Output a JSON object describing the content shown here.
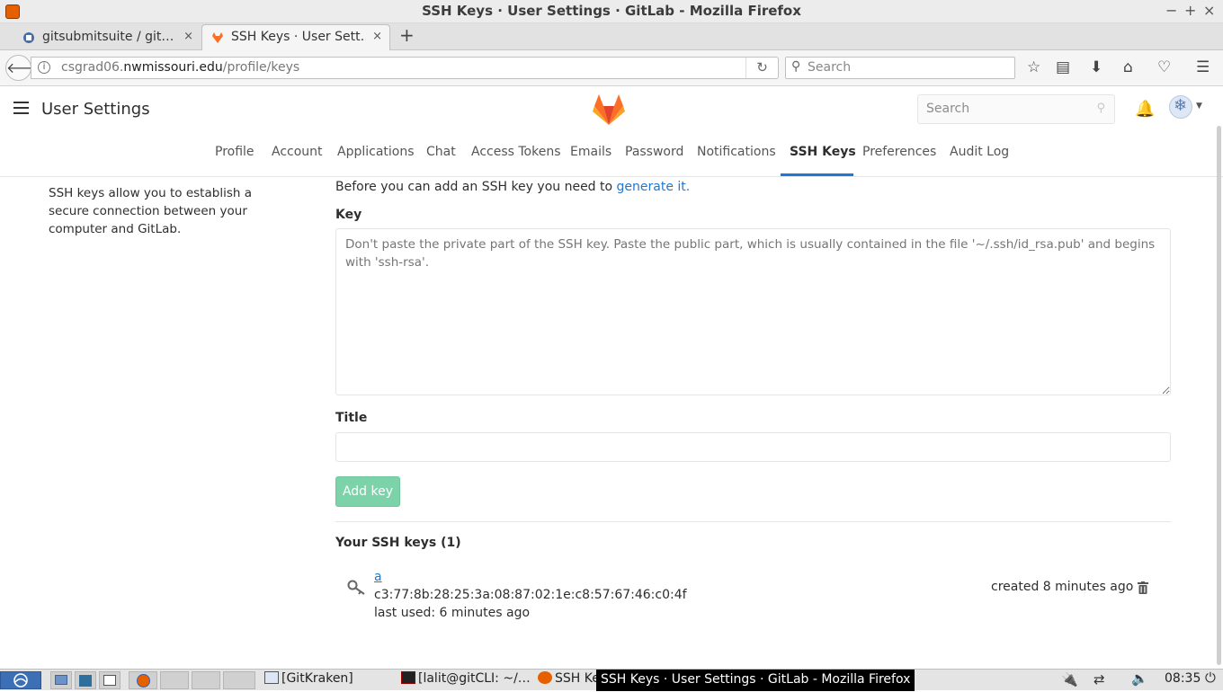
{
  "window": {
    "title": "SSH Keys · User Settings · GitLab - Mozilla Firefox",
    "controls": [
      "−",
      "+",
      "×"
    ]
  },
  "tabs": [
    {
      "label": "gitsubmitsuite / git…",
      "active": false,
      "close": "×"
    },
    {
      "label": "SSH Keys · User Sett…",
      "active": true,
      "close": "×"
    }
  ],
  "newtab_label": "+",
  "navbar": {
    "url_prefix": "csgrad06.",
    "url_host": "nwmissouri.edu",
    "url_path": "/profile/keys",
    "search_placeholder": "Search"
  },
  "header": {
    "title": "User Settings",
    "search_placeholder": "Search",
    "brand_colors": {
      "orange": "#fc6d26",
      "red": "#e24329",
      "light": "#fca326"
    }
  },
  "subnav": {
    "items": [
      "Profile",
      "Account",
      "Applications",
      "Chat",
      "Access Tokens",
      "Emails",
      "Password",
      "Notifications",
      "SSH Keys",
      "Preferences",
      "Audit Log"
    ],
    "active": "SSH Keys",
    "accent": "#1f78d1"
  },
  "content": {
    "left_description": "SSH keys allow you to establish a secure connection between your computer and GitLab.",
    "intro_text": "Before you can add an SSH key you need to ",
    "intro_link": "generate it.",
    "key_label": "Key",
    "key_placeholder": "Don't paste the private part of the SSH key. Paste the public part, which is usually contained in the file '~/.ssh/id_rsa.pub' and begins with 'ssh-rsa'.",
    "title_label": "Title",
    "title_value": "",
    "add_button": "Add key",
    "your_keys_heading": "Your SSH keys (1)",
    "keys": [
      {
        "name": "a",
        "fingerprint": "c3:77:8b:28:25:3a:08:87:02:1e:c8:57:67:46:c0:4f",
        "last_used": "last used: 6 minutes ago",
        "created": "created 8 minutes ago"
      }
    ]
  },
  "taskbar": {
    "tasks": [
      "[GitKraken]",
      "[lalit@gitCLI: ~/…",
      "SSH Ke"
    ],
    "tooltip": "SSH Keys · User Settings · GitLab - Mozilla Firefox",
    "clock": "08:35"
  }
}
